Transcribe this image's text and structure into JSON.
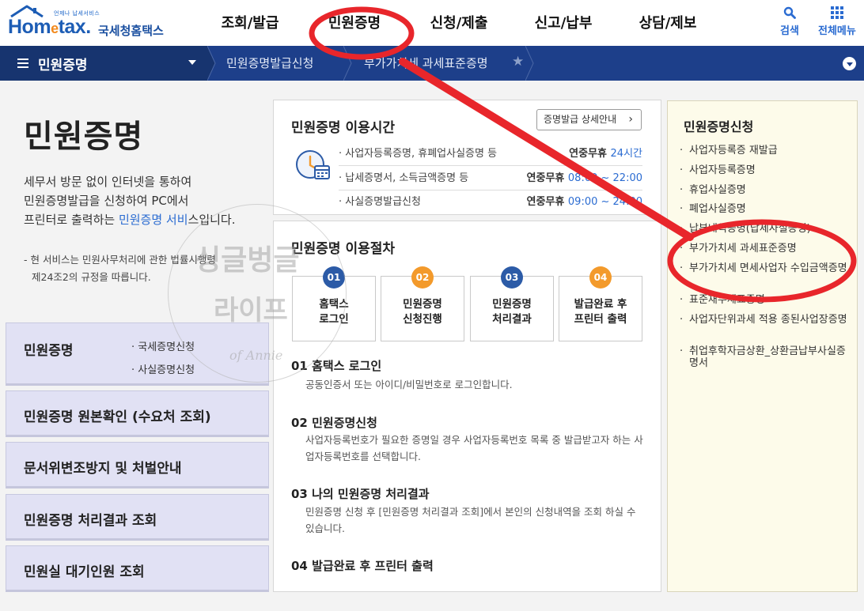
{
  "header": {
    "logo_tagline": "언제나 납세서비스",
    "logo_brand_1": "Hom",
    "logo_brand_e": "e",
    "logo_brand_2": "tax.",
    "logo_korean": "국세청홈택스",
    "gnb": [
      "조회/발급",
      "민원증명",
      "신청/제출",
      "신고/납부",
      "상담/제보"
    ],
    "search_label": "검색",
    "fullmenu_label": "전체메뉴"
  },
  "navbar": {
    "main_menu": "민원증명",
    "crumbs": [
      "민원증명발급신청",
      "부가가치세 과세표준증명"
    ]
  },
  "intro": {
    "title": "민원증명",
    "desc_1": "세무서 방문 없이 인터넷을 통하여",
    "desc_2": "민원증명발급을 신청하여 PC에서",
    "desc_3a": "프린터로 출력하는 ",
    "desc_3b": "민원증명 서비",
    "desc_3c": "스입니다.",
    "note_1": "- 현 서비스는 민원사무처리에 관한 법률시행령",
    "note_2": "제24조2의 규정을 따릅니다."
  },
  "watermark": {
    "line1": "싱글벙글",
    "line2": "라이프",
    "line3": "of Annie"
  },
  "left_nav": [
    {
      "title": "민원증명",
      "subs": [
        "국세증명신청",
        "사실증명신청"
      ]
    },
    {
      "title": "민원증명 원본확인 (수요처 조회)"
    },
    {
      "title": "문서위변조방지 및 처벌안내"
    },
    {
      "title": "민원증명 처리결과 조회"
    },
    {
      "title": "민원실 대기인원 조회"
    }
  ],
  "usage_time": {
    "title": "민원증명 이용시간",
    "detail_button": "증명발급 상세안내",
    "rows": [
      {
        "name": "사업자등록증명, 휴폐업사실증명 등",
        "prefix": "연중무휴 ",
        "value": "24시간"
      },
      {
        "name": "납세증명서, 소득금액증명 등",
        "prefix": "연중무휴 ",
        "value": "08:00 ~ 22:00"
      },
      {
        "name": "사실증명발급신청",
        "prefix": "연중무휴 ",
        "value": "09:00 ~ 24:00"
      }
    ]
  },
  "procedure": {
    "title": "민원증명 이용절차",
    "steps": [
      {
        "num": "01",
        "line1": "홈택스",
        "line2": "로그인"
      },
      {
        "num": "02",
        "line1": "민원증명",
        "line2": "신청진행"
      },
      {
        "num": "03",
        "line1": "민원증명",
        "line2": "처리결과"
      },
      {
        "num": "04",
        "line1": "발급완료 후",
        "line2": "프린터 출력"
      }
    ],
    "details": [
      {
        "heading": "01 홈택스 로그인",
        "desc": "공동인증서 또는 아이디/비밀번호로 로그인합니다."
      },
      {
        "heading": "02 민원증명신청",
        "desc": "사업자등록번호가 필요한 증명일 경우 사업자등록번호 목록 중 발급받고자 하는 사업자등록번호를 선택합니다."
      },
      {
        "heading": "03 나의 민원증명 처리결과",
        "desc": "민원증명 신청 후 [민원증명 처리결과 조회]에서 본인의 신청내역을 조회 하실 수 있습니다."
      },
      {
        "heading": "04 발급완료 후 프린터 출력",
        "desc": ""
      }
    ]
  },
  "right_panel": {
    "title": "민원증명신청",
    "items": [
      "사업자등록증 재발급",
      "사업자등록증명",
      "휴업사실증명",
      "폐업사실증명",
      "납부내역증명(납세사실증명)",
      "부가가치세 과세표준증명",
      "부가가치세 면세사업자 수입금액증명",
      "표준재무제표증명",
      "사업자단위과세 적용 종된사업장증명",
      "취업후학자금상환_상환금납부사실증명서"
    ]
  },
  "colors": {
    "brand_blue": "#1d5db5",
    "nav_bg": "#1d3f8a",
    "step_blue": "#2c5ba7",
    "step_orange": "#f39a2b",
    "annotation_red": "#e8262b",
    "left_nav_bg": "#e1e1f4",
    "right_panel_bg": "#fdfbea"
  },
  "icons": [
    "hometax-roof-icon",
    "search-icon",
    "grid-menu-icon",
    "hamburger-icon",
    "caret-down-icon",
    "star-icon",
    "circle-down-icon",
    "clock-calendar-icon",
    "chevron-right-icon"
  ]
}
